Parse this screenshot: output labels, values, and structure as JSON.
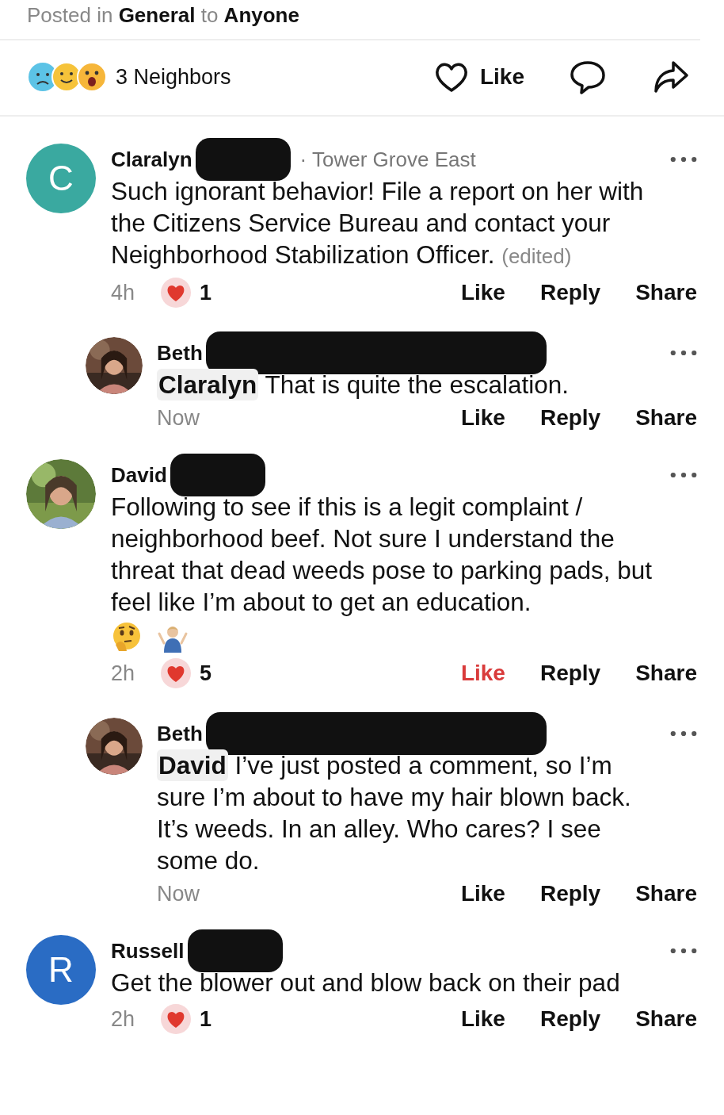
{
  "post": {
    "prefix": "Posted in",
    "category": "General",
    "joiner": "to",
    "audience": "Anyone"
  },
  "reactions": {
    "count": "3 Neighbors",
    "like": "Like"
  },
  "comments": [
    {
      "avatar": {
        "kind": "letter",
        "letter": "C",
        "color": "#3aa9a0"
      },
      "name": "Claralyn",
      "redacted": true,
      "location": "· Tower Grove East",
      "body": "Such ignorant behavior! File a report on her with the Citizens Service Bureau and contact your Neighborhood Stabilization Officer.",
      "edited": "(edited)",
      "emoji_row": false,
      "time": "4h",
      "hearts": "1",
      "liked": false,
      "actions": [
        "Like",
        "Reply",
        "Share"
      ],
      "children": [
        {
          "name": "Beth",
          "redacted": true,
          "mention": "Claralyn",
          "body": "That is quite the escalation.",
          "emoji_row": false,
          "time": "Now",
          "liked": false,
          "actions": [
            "Like",
            "Reply",
            "Share"
          ]
        }
      ]
    },
    {
      "name": "David",
      "redacted": true,
      "body": "Following to see if this is a legit complaint / neighborhood beef. Not sure I understand the threat that dead weeds pose to parking pads, but feel like I’m about to get an education.",
      "emoji_row": true,
      "time": "2h",
      "hearts": "5",
      "liked": true,
      "actions": [
        "Like",
        "Reply",
        "Share"
      ],
      "children": [
        {
          "name": "Beth",
          "redacted": true,
          "mention": "David",
          "body": "I’ve just posted a comment, so I’m sure I’m about to have my hair blown back. It’s weeds. In an alley. Who cares? I see some do.",
          "emoji_row": false,
          "time": "Now",
          "liked": false,
          "actions": [
            "Like",
            "Reply",
            "Share"
          ]
        }
      ]
    },
    {
      "avatar": {
        "kind": "letter",
        "letter": "R",
        "color": "#2a6cc4"
      },
      "name": "Russell",
      "redacted": true,
      "body": "Get the blower out and blow back on their pad",
      "emoji_row": false,
      "time": "2h",
      "hearts": "1",
      "liked": false,
      "actions": [
        "Like",
        "Reply",
        "Share"
      ]
    }
  ]
}
